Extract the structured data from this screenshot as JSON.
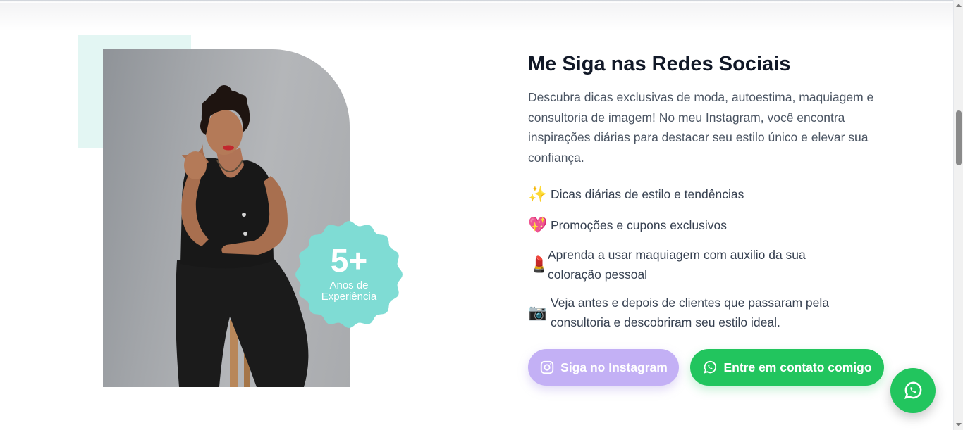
{
  "section": {
    "title": "Me Siga nas Redes Sociais",
    "description": "Descubra dicas exclusivas de moda, autoestima, maquiagem e consultoria de imagem! No meu Instagram, você encontra inspirações diárias para destacar seu estilo único e elevar sua confiança.",
    "features": [
      {
        "icon": "sparkles-icon",
        "emoji": "✨",
        "text": "Dicas diárias de estilo e tendências"
      },
      {
        "icon": "sparkling-heart-icon",
        "emoji": "💖",
        "text": "Promoções e cupons exclusivos"
      },
      {
        "icon": "lipstick-icon",
        "emoji": "💄",
        "text": "Aprenda a usar maquiagem com auxilio da sua coloração pessoal"
      },
      {
        "icon": "camera-icon",
        "emoji": "📷",
        "text": "Veja antes e depois de clientes que passaram pela consultoria e descobriram seu estilo ideal."
      }
    ]
  },
  "badge": {
    "number": "5+",
    "label": "Anos de Experiência",
    "color": "#7fdcd4"
  },
  "buttons": {
    "instagram_label": "Siga no Instagram",
    "whatsapp_label": "Entre em contato comigo"
  },
  "colors": {
    "instagram_button": "#c3b0f5",
    "whatsapp_button": "#22c55e",
    "accent_square": "#e3f6f3",
    "title": "#111827"
  }
}
